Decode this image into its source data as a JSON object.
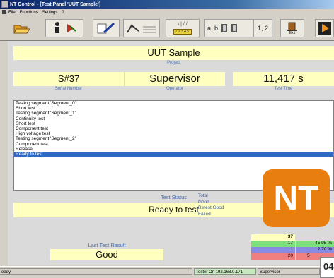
{
  "window": {
    "title": "NT Control - [Test Panel 'UUT Sample']"
  },
  "menu": {
    "items": [
      "File",
      "Functions",
      "Settings",
      "?"
    ]
  },
  "toolbar": {
    "btn_ab": "a, b",
    "btn_12": "1, 2",
    "btn_exit": "Exit",
    "btn_led": "1.2.3.4.5."
  },
  "panel": {
    "project_value": "UUT Sample",
    "project_label": "Project",
    "serial_value": "S#37",
    "serial_label": "Serial Number",
    "operator_value": "Supervisor",
    "operator_label": "Operator",
    "time_value": "11,417 s",
    "time_label": "Test Time",
    "log": [
      "Testing segment 'Segment_0'",
      "Short test",
      "Testing segment 'Segment_1'",
      "Continuity test",
      "Short test",
      "Component test",
      "High voltage test",
      "Testing segment 'Segment_2'",
      "Component test",
      "Release",
      "Ready to test"
    ],
    "test_status_label": "Test Status",
    "test_status_value": "Ready to test",
    "last_result_label": "Last Test Result",
    "last_result_value": "Good",
    "stats": {
      "total_label": "Total",
      "good_label": "Good",
      "retest_label": "Retest Good",
      "failed_label": "Failed",
      "total_count": "37",
      "good_count": "17",
      "good_pct": "45,95 %",
      "retest_count": "1",
      "retest_pct": "2,70 %",
      "failed_count": "20",
      "failed_pct": "5"
    }
  },
  "statusbar": {
    "ready": "eady",
    "tester": "Tester On 192.168.0.171",
    "user": "Supervisor"
  },
  "logo": {
    "text": "NT"
  },
  "overlay": {
    "text": "04"
  },
  "colors": {
    "field_bg": "#ffffc0",
    "caption": "#4a70b0",
    "good_green": "#7de07d",
    "retest_blue": "#8a8ae0",
    "failed_red": "#f08080",
    "logo_orange": "#e87d10",
    "selection": "#316ac5"
  }
}
